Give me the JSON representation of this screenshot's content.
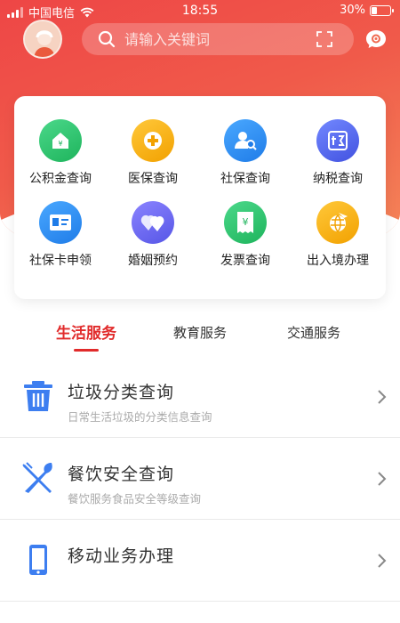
{
  "status_bar": {
    "carrier": "中国电信",
    "time": "18:55",
    "battery_percent": "30%",
    "battery_level": 0.3
  },
  "search": {
    "placeholder": "请输入关键词"
  },
  "services": [
    {
      "label": "公积金查询",
      "icon": "housing-fund-icon",
      "color": "#2dc36a"
    },
    {
      "label": "医保查询",
      "icon": "medical-insurance-icon",
      "color": "#f6b40e"
    },
    {
      "label": "社保查询",
      "icon": "social-security-icon",
      "color": "#2f8ff3"
    },
    {
      "label": "纳税查询",
      "icon": "tax-icon",
      "color": "#5167e8"
    },
    {
      "label": "社保卡申领",
      "icon": "id-card-icon",
      "color": "#2a8ef0"
    },
    {
      "label": "婚姻预约",
      "icon": "marriage-heart-icon",
      "color": "#6b6cf0"
    },
    {
      "label": "发票查询",
      "icon": "invoice-icon",
      "color": "#27c271"
    },
    {
      "label": "出入境办理",
      "icon": "globe-plane-icon",
      "color": "#f4a20b"
    }
  ],
  "tabs": [
    {
      "label": "生活服务",
      "active": true
    },
    {
      "label": "教育服务",
      "active": false
    },
    {
      "label": "交通服务",
      "active": false
    }
  ],
  "list": [
    {
      "title": "垃圾分类查询",
      "subtitle": "日常生活垃圾的分类信息查询",
      "icon": "trash-bin-icon"
    },
    {
      "title": "餐饮安全查询",
      "subtitle": "餐饮服务食品安全等级查询",
      "icon": "fork-knife-icon"
    },
    {
      "title": "移动业务办理",
      "subtitle": "",
      "icon": "mobile-phone-icon"
    }
  ],
  "colors": {
    "brand_red": "#e12b2b",
    "header_gradient_start": "#ee4646",
    "header_gradient_end": "#f58a5a",
    "list_icon_blue": "#3d7ef0"
  }
}
